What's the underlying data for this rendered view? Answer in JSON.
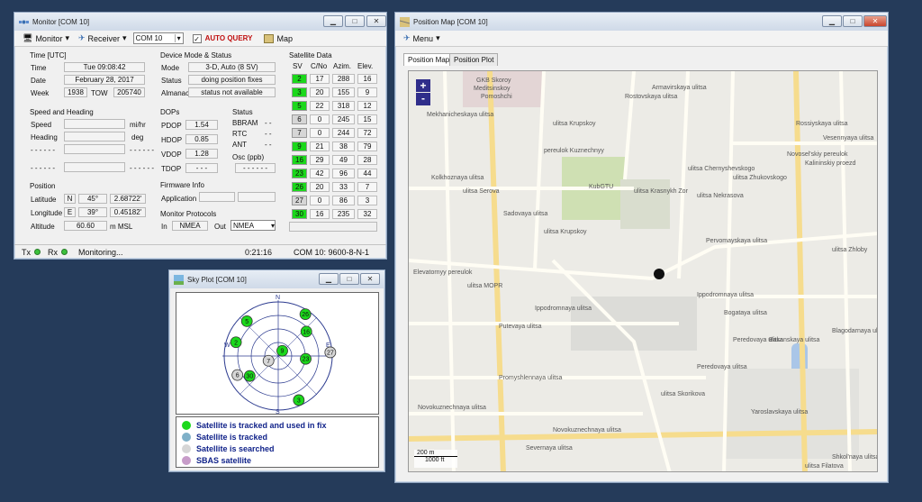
{
  "monitor": {
    "title": "Monitor [COM 10]",
    "menu_monitor": "Monitor",
    "menu_receiver": "Receiver",
    "com_value": "COM 10",
    "auto_query": "AUTO QUERY",
    "map_button": "Map",
    "time_group": "Time [UTC]",
    "time_label": "Time",
    "time_value": "Tue 09:08:42",
    "date_label": "Date",
    "date_value": "February 28, 2017",
    "week_label": "Week",
    "week_value": "1938",
    "tow_label": "TOW",
    "tow_value": "205740",
    "speed_group": "Speed and Heading",
    "speed_label": "Speed",
    "speed_unit": "mi/hr",
    "heading_label": "Heading",
    "heading_unit": "deg",
    "dashes": "- - - - - -",
    "pos_group": "Position",
    "lat_label": "Latitude",
    "lat_hemi": "N",
    "lat_deg": "45°",
    "lat_min": "2.68722'",
    "lon_label": "Longitude",
    "lon_hemi": "E",
    "lon_deg": "39°",
    "lon_min": "0.45182'",
    "alt_label": "Altitude",
    "alt_value": "60.60",
    "alt_unit": "m MSL",
    "mode_group": "Device Mode & Status",
    "mode_label": "Mode",
    "mode_value": "3-D, Auto (8 SV)",
    "status_label": "Status",
    "status_value": "doing position fixes",
    "almanac_label": "Almanac",
    "almanac_value": "status not available",
    "dops_group": "DOPs",
    "pdop_label": "PDOP",
    "pdop": "1.54",
    "hdop_label": "HDOP",
    "hdop": "0.85",
    "vdop_label": "VDOP",
    "vdop": "1.28",
    "tdop_label": "TDOP",
    "tdop": "- - -",
    "stat_group": "Status",
    "bbram_label": "BBRAM",
    "bbram": "- -",
    "rtc_label": "RTC",
    "rtc": "- -",
    "ant_label": "ANT",
    "ant": "- -",
    "osc_label": "Osc (ppb)",
    "osc": "- - - - - -",
    "fw_group": "Firmware Info",
    "app_label": "Application",
    "proto_group": "Monitor Protocols",
    "in_label": "In",
    "in_value": "NMEA",
    "out_label": "Out",
    "out_value": "NMEA",
    "sat_group": "Satellite Data",
    "h_sv": "SV",
    "h_cno": "C/No",
    "h_az": "Azim.",
    "h_el": "Elev.",
    "sats": [
      [
        "2",
        "17",
        "288",
        "16",
        "g"
      ],
      [
        "3",
        "20",
        "155",
        "9",
        "g"
      ],
      [
        "5",
        "22",
        "318",
        "12",
        "g"
      ],
      [
        "6",
        "0",
        "245",
        "15",
        "s"
      ],
      [
        "7",
        "0",
        "244",
        "72",
        "s"
      ],
      [
        "9",
        "21",
        "38",
        "79",
        "g"
      ],
      [
        "16",
        "29",
        "49",
        "28",
        "g"
      ],
      [
        "23",
        "42",
        "96",
        "44",
        "g"
      ],
      [
        "26",
        "20",
        "33",
        "7",
        "g"
      ],
      [
        "27",
        "0",
        "86",
        "3",
        "s"
      ],
      [
        "30",
        "16",
        "235",
        "32",
        "g"
      ]
    ],
    "tx": "Tx",
    "rx": "Rx",
    "monitoring": "Monitoring...",
    "elapsed": "0:21:16",
    "port_info": "COM 10: 9600-8-N-1"
  },
  "sky": {
    "title": "Sky Plot [COM 10]",
    "N": "N",
    "S": "S",
    "E": "E",
    "W": "W",
    "legend": [
      "Satellite is tracked and used in fix",
      "Satellite is tracked",
      "Satellite is searched",
      "SBAS satellite"
    ],
    "legend_colors": [
      "#1bd81b",
      "#7fb0c8",
      "#d6d6d6",
      "#c79cc9"
    ]
  },
  "map": {
    "title": "Position Map [COM 10]",
    "menu": "Menu",
    "tab_map": "Position Map",
    "tab_plot": "Position Plot",
    "zoom_in": "+",
    "zoom_out": "-",
    "scale_m": "200 m",
    "scale_ft": "1000 ft",
    "labels": [
      "GKB Skoroy",
      "Meditsinskoy",
      "Pomoshchi",
      "KubGTU",
      "Rossiyskaya ulitsa",
      "Vesennyaya ulitsa",
      "Novosel'skiy pereulok",
      "Kalininskiy proezd",
      "ulitsa Krasnykh Zor",
      "Pervomayskaya ulitsa",
      "ulitsa Zhloby",
      "ulitsa MOPR",
      "Ippodromnaya ulitsa",
      "Putevaya ulitsa",
      "Promyshlennaya ulitsa",
      "Novokuznechnaya ulitsa",
      "Severnaya ulitsa",
      "ulitsa Filatova",
      "Shkol'naya ulitsa",
      "Bakanskaya ulitsa",
      "Blagodarnaya ulitsa",
      "Sadovaya ulitsa",
      "Elevatornyy pereulok",
      "Kolkhoznaya ulitsa",
      "ulitsa Serova",
      "Bogataya ulitsa",
      "Peredovaya ulitsa",
      "ulitsa Skorikova",
      "Rostovskaya ulitsa",
      "Armavirskaya ulitsa",
      "ulitsa Chernyshevskogo",
      "ulitsa Nekrasova",
      "ulitsa Zhukovskogo",
      "Mekhanicheskaya ulitsa",
      "ulitsa Krupskoy",
      "Ippodromnaya ulitsa",
      "Novokuznechnaya ulitsa",
      "ulitsa Krupskoy",
      "Peredovaya ulitsa",
      "Yaroslavskaya ulitsa",
      "pereulok Kuznechnyy"
    ]
  }
}
